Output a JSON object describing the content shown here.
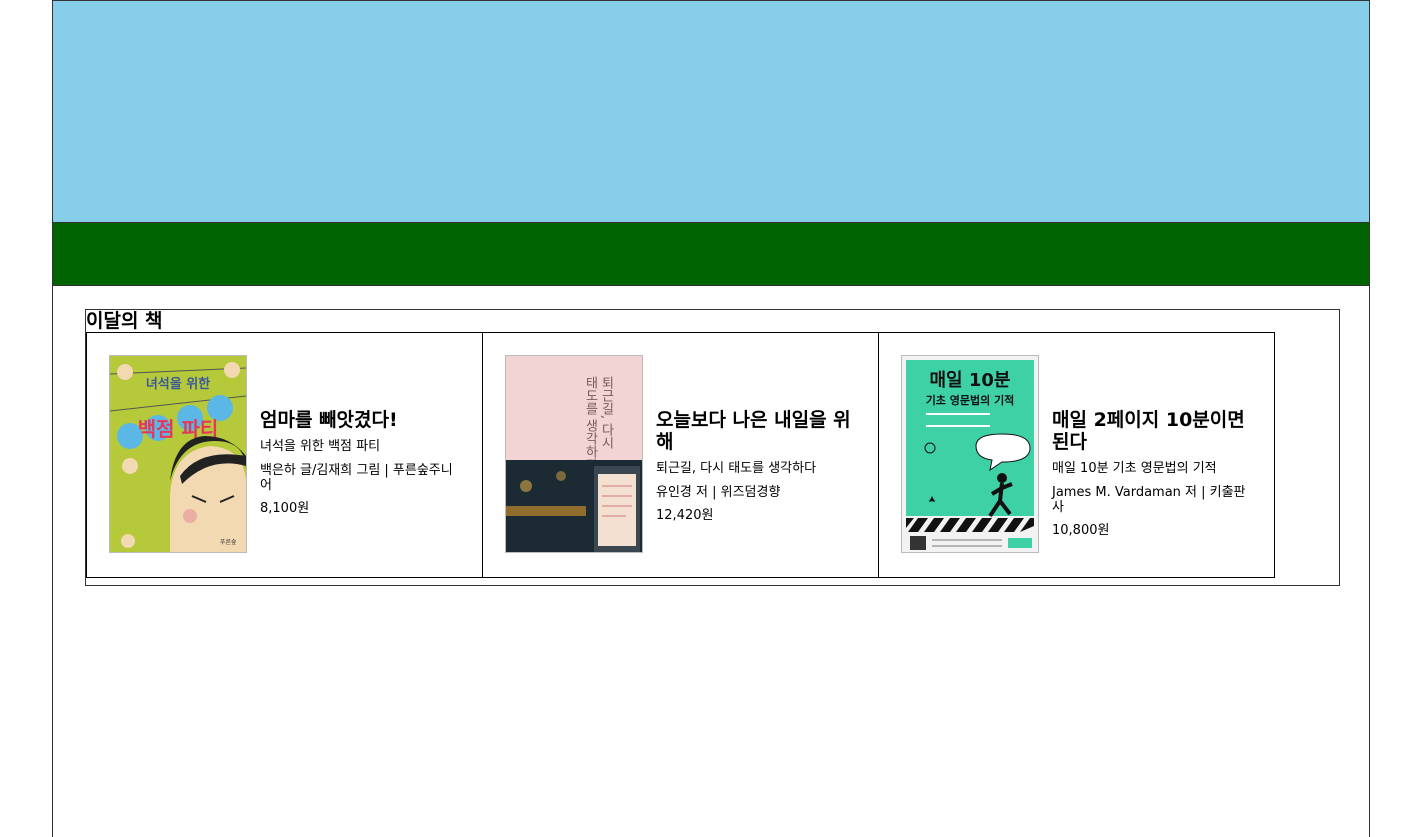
{
  "section": {
    "title": "이달의 책"
  },
  "books": [
    {
      "title": "엄마를 빼앗겼다!",
      "subtitle": "녀석을 위한 백점 파티",
      "author": "백은하 글/김재희 그림 | 푸른숲주니어",
      "price": "8,100원",
      "cover_text": [
        "녀석을 위한",
        "백점 파티"
      ]
    },
    {
      "title": "오늘보다 나은 내일을 위해",
      "subtitle": "퇴근길, 다시 태도를 생각하다",
      "author": "유인경 저 | 위즈덤경향",
      "price": "12,420원",
      "cover_text": [
        "퇴근길, 다시",
        "태도를 생각하다"
      ]
    },
    {
      "title": "매일 2페이지 10분이면 된다",
      "subtitle": "매일 10분 기초 영문법의 기적",
      "author": "James M. Vardaman 저 | 키출판사",
      "price": "10,800원",
      "cover_text": [
        "매일 10분",
        "기초 영문법의 기적"
      ]
    }
  ],
  "colors": {
    "sky": "#87ceeb",
    "grass": "#006400"
  }
}
